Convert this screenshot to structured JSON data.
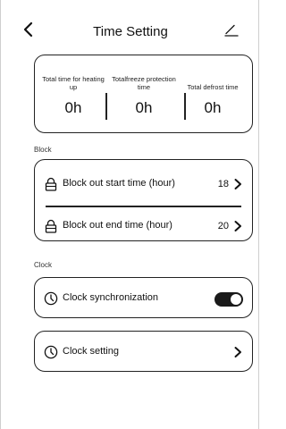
{
  "header": {
    "title": "Time Setting",
    "back_icon": "chevron-left-icon",
    "edit_icon": "pencil-icon"
  },
  "stats": [
    {
      "label": "Total time for heating up",
      "value": "0h"
    },
    {
      "label": "Totalfreeze protection time",
      "value": "0h"
    },
    {
      "label": "Total defrost time",
      "value": "0h"
    }
  ],
  "block": {
    "section_label": "Block",
    "items": [
      {
        "label": "Block out start time (hour)",
        "value": "18",
        "icon": "lock-icon"
      },
      {
        "label": "Block out end time (hour)",
        "value": "20",
        "icon": "lock-icon"
      }
    ]
  },
  "clock": {
    "section_label": "Clock",
    "sync_label": "Clock synchronization",
    "sync_enabled": true,
    "setting_label": "Clock setting",
    "icon": "clock-icon"
  },
  "colors": {
    "border": "#222222",
    "toggle_on": "#1a1a1a",
    "background": "#ffffff"
  }
}
